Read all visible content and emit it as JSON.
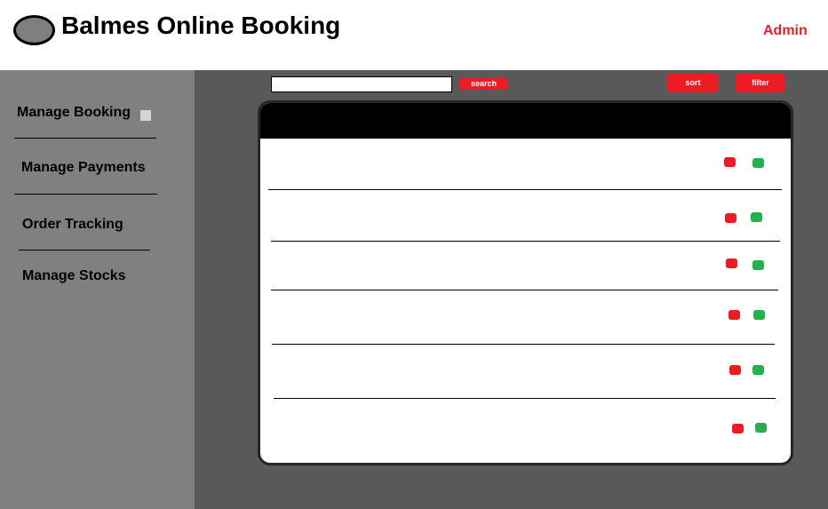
{
  "header": {
    "title": "Balmes Online Booking",
    "user": "Admin"
  },
  "sidebar": {
    "items": [
      {
        "label": "Manage Booking"
      },
      {
        "label": "Manage Payments"
      },
      {
        "label": "Order Tracking"
      },
      {
        "label": "Manage Stocks"
      }
    ]
  },
  "toolbar": {
    "search_value": "",
    "search_label": "search",
    "sort_label": "sort",
    "filter_label": "filter"
  },
  "table": {
    "rows": [
      {
        "actions": [
          "red-button",
          "green-button"
        ]
      },
      {
        "actions": [
          "red-button",
          "green-button"
        ]
      },
      {
        "actions": [
          "red-button",
          "green-button"
        ]
      },
      {
        "actions": [
          "red-button",
          "green-button"
        ]
      },
      {
        "actions": [
          "red-button",
          "green-button"
        ]
      },
      {
        "actions": [
          "red-button",
          "green-button"
        ]
      }
    ]
  },
  "colors": {
    "accent_red": "#ed1c24",
    "accent_green": "#22b14c",
    "sidebar": "#808080",
    "content_bg": "#595959"
  }
}
